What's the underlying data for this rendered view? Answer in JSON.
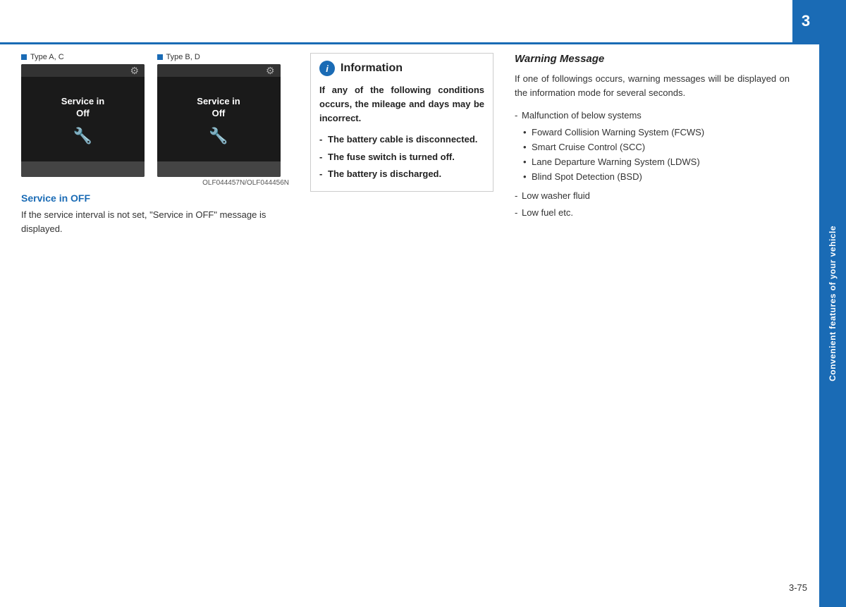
{
  "page": {
    "top_line_color": "#1a6bb5",
    "chapter_number": "3",
    "sidebar_text": "Convenient features of your vehicle",
    "page_number": "3-75"
  },
  "images": {
    "type_a_c_label": "Type A, C",
    "type_b_d_label": "Type B, D",
    "caption": "OLF044457N/OLF044456N",
    "service_text_line1": "Service in",
    "service_text_line2": "Off"
  },
  "service_off": {
    "title": "Service in OFF",
    "text": "If the service interval is not set, \"Service in OFF\" message is displayed."
  },
  "information": {
    "icon_label": "i",
    "title": "Information",
    "intro": "If any of the following conditions occurs, the mileage and days may be incorrect.",
    "list": [
      "The battery cable is disconnected.",
      "The fuse switch is turned off.",
      "The battery is discharged."
    ]
  },
  "warning_message": {
    "title": "Warning Message",
    "intro": "If one of followings occurs, warning messages will be displayed on the information mode for several seconds.",
    "malfunction_label": "Malfunction of below systems",
    "systems": [
      "Foward Collision Warning System (FCWS)",
      "Smart Cruise Control (SCC)",
      "Lane Departure Warning System (LDWS)",
      "Blind Spot Detection (BSD)"
    ],
    "other_items": [
      "Low washer fluid",
      "Low fuel etc."
    ]
  }
}
